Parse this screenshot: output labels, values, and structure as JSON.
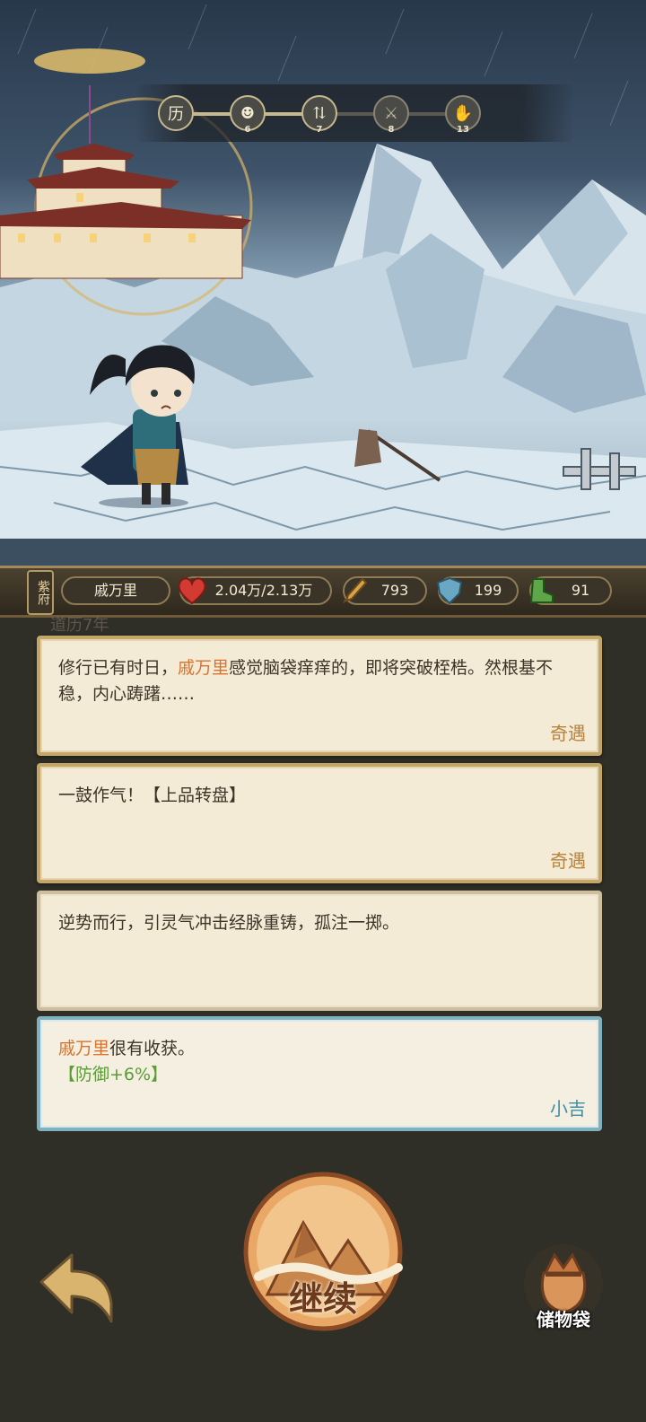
{
  "progress": {
    "nodes": [
      {
        "icon": "calendar-icon",
        "glyph": "历",
        "number": ""
      },
      {
        "icon": "demon-face-icon",
        "glyph": "☻",
        "number": "6"
      },
      {
        "icon": "crossroads-icon",
        "glyph": "⇅",
        "number": "7"
      },
      {
        "icon": "crossed-swords-icon",
        "glyph": "⚔",
        "number": "8"
      },
      {
        "icon": "hand-icon",
        "glyph": "✋",
        "number": "13"
      }
    ],
    "path_color": "#c7b98d"
  },
  "status": {
    "realm": "紫府",
    "name": "戚万里",
    "hp": "2.04万/2.13万",
    "attack": "793",
    "defense": "199",
    "speed": "91"
  },
  "events": [
    {
      "name": "戚万里",
      "text_after": "感觉脑袋痒痒的，即将突破桎梏。然根基不稳，内心踌躇……",
      "text_before": "修行已有时日，",
      "tag": "奇遇"
    },
    {
      "text": "一鼓作气！【上品转盘】",
      "tag": "奇遇"
    },
    {
      "text": "逆势而行，引灵气冲击经脉重铸，孤注一掷。",
      "tag": ""
    },
    {
      "name": "戚万里",
      "text_after": "很有收获。",
      "effect": "【防御+6%】",
      "tag": "小吉"
    }
  ],
  "ghost_label": "道历7年",
  "buttons": {
    "continue": "继续",
    "bag": "储物袋"
  },
  "colors": {
    "highlight": "#d7732e",
    "effect": "#5a9d35",
    "tag": "#b9833e",
    "tag_good": "#3a8ea4"
  }
}
